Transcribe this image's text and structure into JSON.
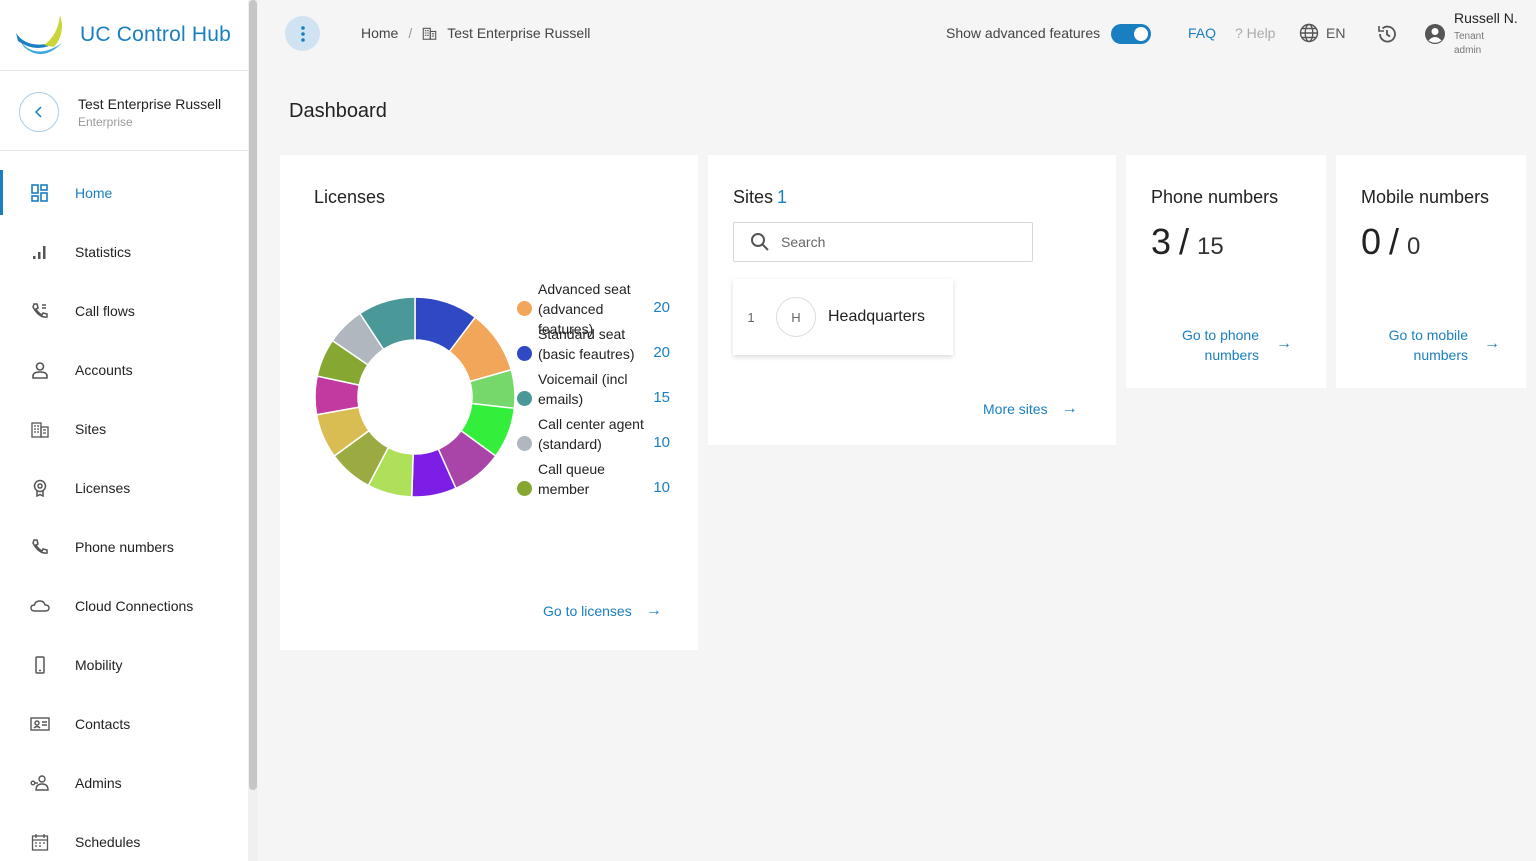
{
  "app": {
    "title": "UC Control Hub"
  },
  "tenant": {
    "name": "Test Enterprise Russell",
    "type": "Enterprise"
  },
  "sidebar": {
    "items": [
      {
        "label": "Home",
        "icon": "dashboard-icon",
        "active": true
      },
      {
        "label": "Statistics",
        "icon": "bar-chart-icon"
      },
      {
        "label": "Call flows",
        "icon": "call-flow-icon"
      },
      {
        "label": "Accounts",
        "icon": "person-icon"
      },
      {
        "label": "Sites",
        "icon": "building-icon"
      },
      {
        "label": "Licenses",
        "icon": "badge-icon"
      },
      {
        "label": "Phone numbers",
        "icon": "phone-icon"
      },
      {
        "label": "Cloud Connections",
        "icon": "cloud-icon"
      },
      {
        "label": "Mobility",
        "icon": "mobile-icon"
      },
      {
        "label": "Contacts",
        "icon": "contact-card-icon"
      },
      {
        "label": "Admins",
        "icon": "admin-icon"
      },
      {
        "label": "Schedules",
        "icon": "calendar-icon"
      }
    ]
  },
  "header": {
    "breadcrumb": {
      "home": "Home",
      "separator": "/",
      "current": "Test Enterprise Russell"
    },
    "advanced_features_label": "Show advanced features",
    "advanced_features_on": true,
    "faq": "FAQ",
    "help": "? Help",
    "language": "EN",
    "user": {
      "name": "Russell N.",
      "role_line1": "Tenant",
      "role_line2": "admin"
    }
  },
  "main": {
    "title": "Dashboard",
    "licenses": {
      "title": "Licenses",
      "legend": [
        {
          "label": "Advanced seat (advanced features)",
          "value": "20",
          "color": "#f2a65a"
        },
        {
          "label": "Standard seat (basic feautres)",
          "value": "20",
          "color": "#2f48c4"
        },
        {
          "label": "Voicemail (incl emails)",
          "value": "15",
          "color": "#4a9898"
        },
        {
          "label": "Call center agent (standard)",
          "value": "10",
          "color": "#b0b7be"
        },
        {
          "label": "Call queue member",
          "value": "10",
          "color": "#86a832"
        }
      ],
      "link": "Go to licenses"
    },
    "sites": {
      "title": "Sites",
      "count": "1",
      "search_placeholder": "Search",
      "items": [
        {
          "index": "1",
          "initial": "H",
          "name": "Headquarters"
        }
      ],
      "link": "More sites"
    },
    "phone_numbers": {
      "title": "Phone numbers",
      "used": "3",
      "separator": "/",
      "total": "15",
      "link_line1": "Go to phone",
      "link_line2": "numbers"
    },
    "mobile_numbers": {
      "title": "Mobile numbers",
      "used": "0",
      "separator": "/",
      "total": "0",
      "link_line1": "Go to mobile",
      "link_line2": "numbers"
    }
  },
  "chart_data": {
    "type": "pie",
    "style": "donut",
    "segments": [
      {
        "color": "#2f48c4",
        "value": 1
      },
      {
        "color": "#f2a65a",
        "value": 1
      },
      {
        "color": "#76d86a",
        "value": 0.6
      },
      {
        "color": "#33ef3b",
        "value": 0.8
      },
      {
        "color": "#a945a8",
        "value": 0.8
      },
      {
        "color": "#7c1ee6",
        "value": 0.7
      },
      {
        "color": "#aee159",
        "value": 0.7
      },
      {
        "color": "#9caa42",
        "value": 0.7
      },
      {
        "color": "#d9bc52",
        "value": 0.7
      },
      {
        "color": "#c2399f",
        "value": 0.6
      },
      {
        "color": "#86a832",
        "value": 0.6
      },
      {
        "color": "#b0b7be",
        "value": 0.6
      },
      {
        "color": "#4a9898",
        "value": 0.9
      }
    ]
  }
}
